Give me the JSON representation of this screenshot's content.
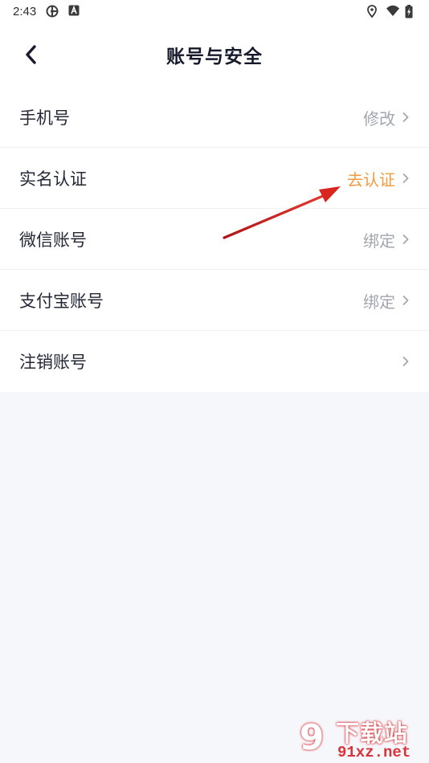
{
  "status_bar": {
    "time": "2:43",
    "left_icons": [
      "network-icon",
      "a-app-icon"
    ],
    "right_icons": [
      "location-icon",
      "wifi-icon",
      "battery-charging-icon"
    ]
  },
  "header": {
    "title": "账号与安全",
    "back_icon": "chevron-left-icon"
  },
  "rows": [
    {
      "label": "手机号",
      "value": "修改",
      "value_color": "#a3a6af"
    },
    {
      "label": "实名认证",
      "value": "去认证",
      "value_color": "#f39a3d"
    },
    {
      "label": "微信账号",
      "value": "绑定",
      "value_color": "#a3a6af"
    },
    {
      "label": "支付宝账号",
      "value": "绑定",
      "value_color": "#a3a6af"
    },
    {
      "label": "注销账号",
      "value": "",
      "value_color": "#a3a6af"
    }
  ],
  "colors": {
    "background": "#f6f7fb",
    "surface": "#ffffff",
    "accent": "#f39a3d",
    "annotation_arrow": "#d8261f"
  },
  "watermark": {
    "logo": "9",
    "title": "下载站",
    "subtitle": "91xz.net"
  }
}
